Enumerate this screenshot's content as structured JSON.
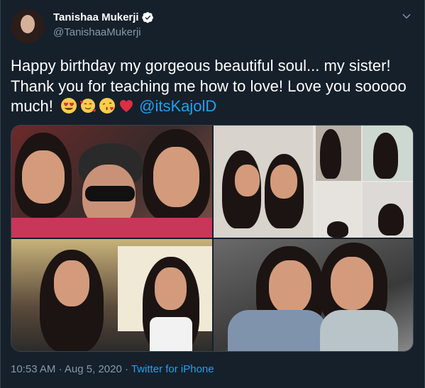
{
  "user": {
    "display_name": "Tanishaa Mukerji",
    "handle": "@TanishaaMukerji",
    "verified": true
  },
  "tweet": {
    "text": "Happy birthday my gorgeous beautiful soul... my sister! Thank you for teaching me how to love! Love you sooooo much!",
    "emojis": [
      "heart-eyes-emoji",
      "smiling-face-with-hearts-emoji",
      "face-blowing-kiss-emoji",
      "red-heart-emoji"
    ],
    "mention": "@itsKajolD"
  },
  "media": {
    "photo_count": 4
  },
  "footer": {
    "time": "10:53 AM",
    "separator": "·",
    "date": "Aug 5, 2020",
    "source": "Twitter for iPhone"
  },
  "colors": {
    "background": "#15202b",
    "text": "#ffffff",
    "secondary_text": "#8899a6",
    "link": "#1da1f2",
    "verified_badge": "#ffffff"
  }
}
